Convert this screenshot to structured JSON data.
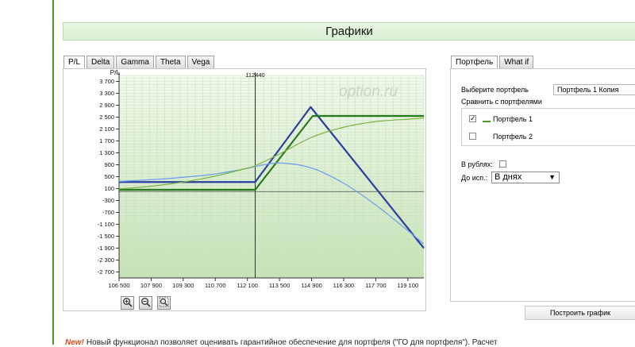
{
  "page": {
    "header_title": "Графики"
  },
  "chart_tabs": [
    "P/L",
    "Delta",
    "Gamma",
    "Theta",
    "Vega"
  ],
  "right_tabs": [
    "Портфель",
    "What if"
  ],
  "right_panel": {
    "select_portfolio_label": "Выберите портфель",
    "selected_portfolio": "Портфель 1 Копия",
    "compare_label": "Сравнить с портфелями",
    "compare_items": [
      {
        "label": "Портфель 1",
        "checked": true
      },
      {
        "label": "Портфель 2",
        "checked": false
      }
    ],
    "in_rubles_label": "В рублях:",
    "expiry_label": "До исп.:",
    "expiry_value": "В днях",
    "build_button": "Построить график"
  },
  "zoom_buttons": [
    "zoom-in-icon",
    "zoom-out-icon",
    "zoom-fit-icon"
  ],
  "news": {
    "badge": "New!",
    "text": "Новый функционал позволяет оценивать гарантийное обеспечение для портфеля (\"ГО для портфеля\"). Расчет"
  },
  "colors": {
    "plot_bg": "#e6f3dc",
    "grid": "#c9e0bc",
    "dark_blue": "#2a3f9e",
    "light_blue": "#6a9df0",
    "dark_green": "#267a1e",
    "light_green": "#7cb342"
  },
  "chart_data": {
    "type": "line",
    "title": "",
    "ylabel": "P/L",
    "marker_label": "112440",
    "watermark": "option.ru",
    "x_ticks": [
      106500,
      107900,
      109300,
      110700,
      112100,
      113500,
      114900,
      116300,
      117700,
      119100
    ],
    "x_tick_labels": [
      "106 500",
      "107 900",
      "109 300",
      "110 700",
      "112 100",
      "113 500",
      "114 900",
      "116 300",
      "117 700",
      "119 100"
    ],
    "y_ticks": [
      3700,
      3300,
      2900,
      2500,
      2100,
      1700,
      1300,
      900,
      500,
      100,
      -300,
      -700,
      -1100,
      -1500,
      -1900,
      -2300,
      -2700
    ],
    "y_tick_labels": [
      "3 700",
      "3 300",
      "2 900",
      "2 500",
      "2 100",
      "1 700",
      "1 300",
      "900",
      "500",
      "100",
      "-300",
      "-700",
      "-1 100",
      "-1 500",
      "-1 900",
      "-2 300",
      "-2 700"
    ],
    "xlim": [
      106500,
      119800
    ],
    "ylim": [
      -2900,
      3900
    ],
    "series": [
      {
        "color": "#2a3f9e",
        "width": 2.2,
        "x": [
          106500,
          112440,
          114860,
          119800
        ],
        "y": [
          320,
          320,
          2840,
          -1900
        ]
      },
      {
        "color": "#267a1e",
        "width": 2.2,
        "x": [
          106500,
          112440,
          114950,
          119800
        ],
        "y": [
          60,
          60,
          2540,
          2540
        ]
      },
      {
        "color": "#6a9df0",
        "width": 1.2,
        "x": [
          106500,
          107900,
          109300,
          110700,
          112100,
          112440,
          113500,
          114900,
          116300,
          117700,
          119100,
          119800
        ],
        "y": [
          340,
          400,
          480,
          590,
          780,
          840,
          960,
          790,
          280,
          -450,
          -1310,
          -1760
        ]
      },
      {
        "color": "#7cb342",
        "width": 1.2,
        "x": [
          106500,
          107900,
          109300,
          110700,
          112100,
          112440,
          113500,
          114900,
          116300,
          117700,
          119100,
          119800
        ],
        "y": [
          90,
          180,
          320,
          520,
          790,
          870,
          1260,
          1820,
          2160,
          2350,
          2430,
          2470
        ]
      }
    ]
  }
}
